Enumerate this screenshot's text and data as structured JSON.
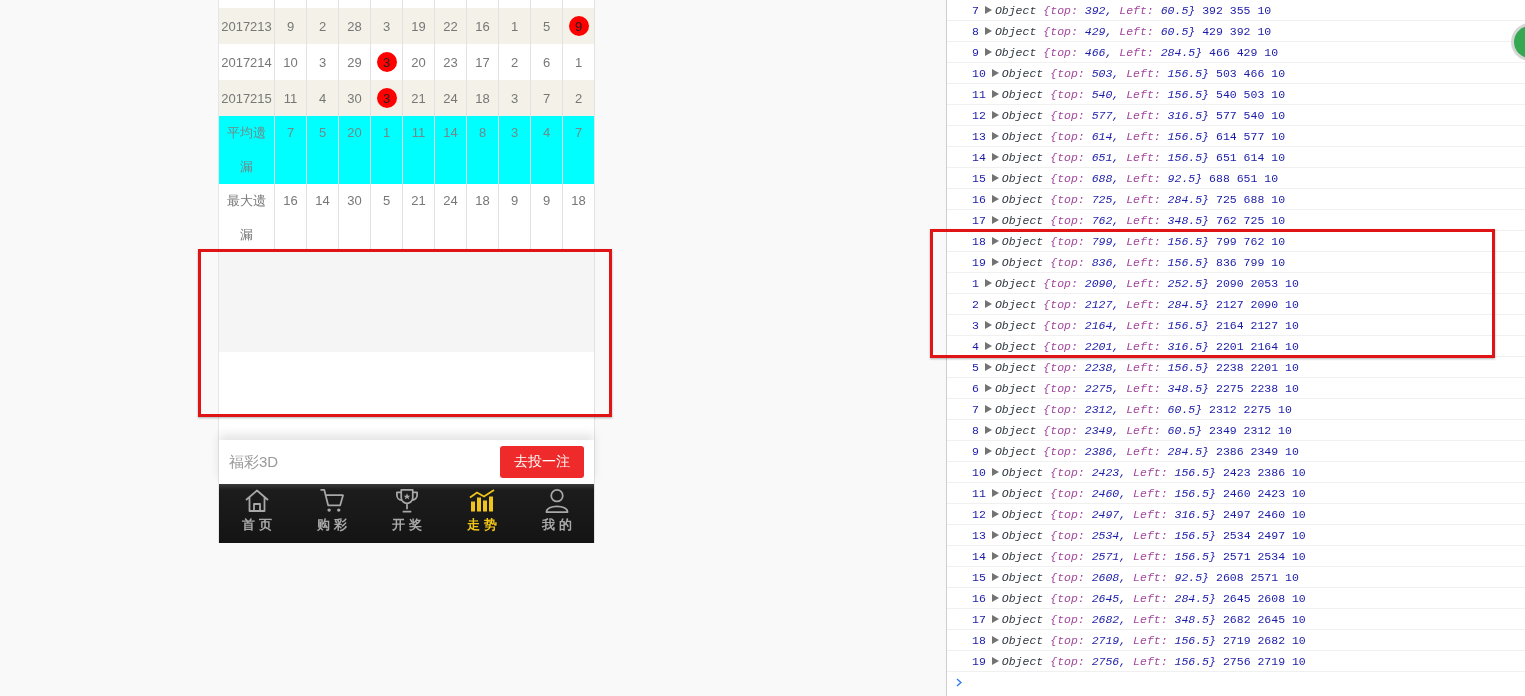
{
  "trend_table": {
    "rows": [
      {
        "kind": "draw",
        "label": "2017213",
        "cells": [
          {
            "text": "9",
            "hit": false
          },
          {
            "text": "2",
            "hit": false
          },
          {
            "text": "28",
            "hit": false
          },
          {
            "text": "3",
            "hit": false
          },
          {
            "text": "19",
            "hit": false
          },
          {
            "text": "22",
            "hit": false
          },
          {
            "text": "16",
            "hit": false
          },
          {
            "text": "1",
            "hit": false
          },
          {
            "text": "5",
            "hit": false
          },
          {
            "text": "9",
            "hit": true
          }
        ]
      },
      {
        "kind": "draw",
        "label": "2017214",
        "cells": [
          {
            "text": "10",
            "hit": false
          },
          {
            "text": "3",
            "hit": false
          },
          {
            "text": "29",
            "hit": false
          },
          {
            "text": "3",
            "hit": true
          },
          {
            "text": "20",
            "hit": false
          },
          {
            "text": "23",
            "hit": false
          },
          {
            "text": "17",
            "hit": false
          },
          {
            "text": "2",
            "hit": false
          },
          {
            "text": "6",
            "hit": false
          },
          {
            "text": "1",
            "hit": false
          }
        ]
      },
      {
        "kind": "draw",
        "label": "2017215",
        "cells": [
          {
            "text": "11",
            "hit": false
          },
          {
            "text": "4",
            "hit": false
          },
          {
            "text": "30",
            "hit": false
          },
          {
            "text": "3",
            "hit": true
          },
          {
            "text": "21",
            "hit": false
          },
          {
            "text": "24",
            "hit": false
          },
          {
            "text": "18",
            "hit": false
          },
          {
            "text": "3",
            "hit": false
          },
          {
            "text": "7",
            "hit": false
          },
          {
            "text": "2",
            "hit": false
          }
        ]
      },
      {
        "kind": "average",
        "label": "平均遗漏",
        "cells": [
          {
            "text": "7",
            "hit": false
          },
          {
            "text": "5",
            "hit": false
          },
          {
            "text": "20",
            "hit": false
          },
          {
            "text": "1",
            "hit": false
          },
          {
            "text": "11",
            "hit": false
          },
          {
            "text": "14",
            "hit": false
          },
          {
            "text": "8",
            "hit": false
          },
          {
            "text": "3",
            "hit": false
          },
          {
            "text": "4",
            "hit": false
          },
          {
            "text": "7",
            "hit": false
          }
        ]
      },
      {
        "kind": "max",
        "label": "最大遗漏",
        "cells": [
          {
            "text": "16",
            "hit": false
          },
          {
            "text": "14",
            "hit": false
          },
          {
            "text": "30",
            "hit": false
          },
          {
            "text": "5",
            "hit": false
          },
          {
            "text": "21",
            "hit": false
          },
          {
            "text": "24",
            "hit": false
          },
          {
            "text": "18",
            "hit": false
          },
          {
            "text": "9",
            "hit": false
          },
          {
            "text": "9",
            "hit": false
          },
          {
            "text": "18",
            "hit": false
          }
        ]
      }
    ]
  },
  "bet_bar": {
    "lottery_name": "福彩3D",
    "button": "去投一注"
  },
  "tab_bar": {
    "items": [
      {
        "label": "首页",
        "selected": false
      },
      {
        "label": "购彩",
        "selected": false
      },
      {
        "label": "开奖",
        "selected": false
      },
      {
        "label": "走势",
        "selected": true
      },
      {
        "label": "我的",
        "selected": false
      }
    ]
  },
  "console": {
    "rows": [
      {
        "index": "7",
        "label": "Object",
        "props": [
          {
            "key": "{top:",
            "value": "392,"
          },
          {
            "key": "Left:",
            "value": "60.5}"
          }
        ],
        "values": "392 355 10"
      },
      {
        "index": "8",
        "label": "Object",
        "props": [
          {
            "key": "{top:",
            "value": "429,"
          },
          {
            "key": "Left:",
            "value": "60.5}"
          }
        ],
        "values": "429 392 10"
      },
      {
        "index": "9",
        "label": "Object",
        "props": [
          {
            "key": "{top:",
            "value": "466,"
          },
          {
            "key": "Left:",
            "value": "284.5}"
          }
        ],
        "values": "466 429 10"
      },
      {
        "index": "10",
        "label": "Object",
        "props": [
          {
            "key": "{top:",
            "value": "503,"
          },
          {
            "key": "Left:",
            "value": "156.5}"
          }
        ],
        "values": "503 466 10"
      },
      {
        "index": "11",
        "label": "Object",
        "props": [
          {
            "key": "{top:",
            "value": "540,"
          },
          {
            "key": "Left:",
            "value": "156.5}"
          }
        ],
        "values": "540 503 10"
      },
      {
        "index": "12",
        "label": "Object",
        "props": [
          {
            "key": "{top:",
            "value": "577,"
          },
          {
            "key": "Left:",
            "value": "316.5}"
          }
        ],
        "values": "577 540 10"
      },
      {
        "index": "13",
        "label": "Object",
        "props": [
          {
            "key": "{top:",
            "value": "614,"
          },
          {
            "key": "Left:",
            "value": "156.5}"
          }
        ],
        "values": "614 577 10"
      },
      {
        "index": "14",
        "label": "Object",
        "props": [
          {
            "key": "{top:",
            "value": "651,"
          },
          {
            "key": "Left:",
            "value": "156.5}"
          }
        ],
        "values": "651 614 10"
      },
      {
        "index": "15",
        "label": "Object",
        "props": [
          {
            "key": "{top:",
            "value": "688,"
          },
          {
            "key": "Left:",
            "value": "92.5}"
          }
        ],
        "values": "688 651 10"
      },
      {
        "index": "16",
        "label": "Object",
        "props": [
          {
            "key": "{top:",
            "value": "725,"
          },
          {
            "key": "Left:",
            "value": "284.5}"
          }
        ],
        "values": "725 688 10"
      },
      {
        "index": "17",
        "label": "Object",
        "props": [
          {
            "key": "{top:",
            "value": "762,"
          },
          {
            "key": "Left:",
            "value": "348.5}"
          }
        ],
        "values": "762 725 10"
      },
      {
        "index": "18",
        "label": "Object",
        "props": [
          {
            "key": "{top:",
            "value": "799,"
          },
          {
            "key": "Left:",
            "value": "156.5}"
          }
        ],
        "values": "799 762 10"
      },
      {
        "index": "19",
        "label": "Object",
        "props": [
          {
            "key": "{top:",
            "value": "836,"
          },
          {
            "key": "Left:",
            "value": "156.5}"
          }
        ],
        "values": "836 799 10"
      },
      {
        "index": "1",
        "label": "Object",
        "props": [
          {
            "key": "{top:",
            "value": "2090,"
          },
          {
            "key": "Left:",
            "value": "252.5}"
          }
        ],
        "values": "2090 2053 10"
      },
      {
        "index": "2",
        "label": "Object",
        "props": [
          {
            "key": "{top:",
            "value": "2127,"
          },
          {
            "key": "Left:",
            "value": "284.5}"
          }
        ],
        "values": "2127 2090 10"
      },
      {
        "index": "3",
        "label": "Object",
        "props": [
          {
            "key": "{top:",
            "value": "2164,"
          },
          {
            "key": "Left:",
            "value": "156.5}"
          }
        ],
        "values": "2164 2127 10"
      },
      {
        "index": "4",
        "label": "Object",
        "props": [
          {
            "key": "{top:",
            "value": "2201,"
          },
          {
            "key": "Left:",
            "value": "316.5}"
          }
        ],
        "values": "2201 2164 10"
      },
      {
        "index": "5",
        "label": "Object",
        "props": [
          {
            "key": "{top:",
            "value": "2238,"
          },
          {
            "key": "Left:",
            "value": "156.5}"
          }
        ],
        "values": "2238 2201 10"
      },
      {
        "index": "6",
        "label": "Object",
        "props": [
          {
            "key": "{top:",
            "value": "2275,"
          },
          {
            "key": "Left:",
            "value": "348.5}"
          }
        ],
        "values": "2275 2238 10"
      },
      {
        "index": "7",
        "label": "Object",
        "props": [
          {
            "key": "{top:",
            "value": "2312,"
          },
          {
            "key": "Left:",
            "value": "60.5}"
          }
        ],
        "values": "2312 2275 10"
      },
      {
        "index": "8",
        "label": "Object",
        "props": [
          {
            "key": "{top:",
            "value": "2349,"
          },
          {
            "key": "Left:",
            "value": "60.5}"
          }
        ],
        "values": "2349 2312 10"
      },
      {
        "index": "9",
        "label": "Object",
        "props": [
          {
            "key": "{top:",
            "value": "2386,"
          },
          {
            "key": "Left:",
            "value": "284.5}"
          }
        ],
        "values": "2386 2349 10"
      },
      {
        "index": "10",
        "label": "Object",
        "props": [
          {
            "key": "{top:",
            "value": "2423,"
          },
          {
            "key": "Left:",
            "value": "156.5}"
          }
        ],
        "values": "2423 2386 10"
      },
      {
        "index": "11",
        "label": "Object",
        "props": [
          {
            "key": "{top:",
            "value": "2460,"
          },
          {
            "key": "Left:",
            "value": "156.5}"
          }
        ],
        "values": "2460 2423 10"
      },
      {
        "index": "12",
        "label": "Object",
        "props": [
          {
            "key": "{top:",
            "value": "2497,"
          },
          {
            "key": "Left:",
            "value": "316.5}"
          }
        ],
        "values": "2497 2460 10"
      },
      {
        "index": "13",
        "label": "Object",
        "props": [
          {
            "key": "{top:",
            "value": "2534,"
          },
          {
            "key": "Left:",
            "value": "156.5}"
          }
        ],
        "values": "2534 2497 10"
      },
      {
        "index": "14",
        "label": "Object",
        "props": [
          {
            "key": "{top:",
            "value": "2571,"
          },
          {
            "key": "Left:",
            "value": "156.5}"
          }
        ],
        "values": "2571 2534 10"
      },
      {
        "index": "15",
        "label": "Object",
        "props": [
          {
            "key": "{top:",
            "value": "2608,"
          },
          {
            "key": "Left:",
            "value": "92.5}"
          }
        ],
        "values": "2608 2571 10"
      },
      {
        "index": "16",
        "label": "Object",
        "props": [
          {
            "key": "{top:",
            "value": "2645,"
          },
          {
            "key": "Left:",
            "value": "284.5}"
          }
        ],
        "values": "2645 2608 10"
      },
      {
        "index": "17",
        "label": "Object",
        "props": [
          {
            "key": "{top:",
            "value": "2682,"
          },
          {
            "key": "Left:",
            "value": "348.5}"
          }
        ],
        "values": "2682 2645 10"
      },
      {
        "index": "18",
        "label": "Object",
        "props": [
          {
            "key": "{top:",
            "value": "2719,"
          },
          {
            "key": "Left:",
            "value": "156.5}"
          }
        ],
        "values": "2719 2682 10"
      },
      {
        "index": "19",
        "label": "Object",
        "props": [
          {
            "key": "{top:",
            "value": "2756,"
          },
          {
            "key": "Left:",
            "value": "156.5}"
          }
        ],
        "values": "2756 2719 10"
      }
    ]
  },
  "annotations": {
    "frame_around_blank_area": true,
    "frame_around_console_rows": true
  }
}
